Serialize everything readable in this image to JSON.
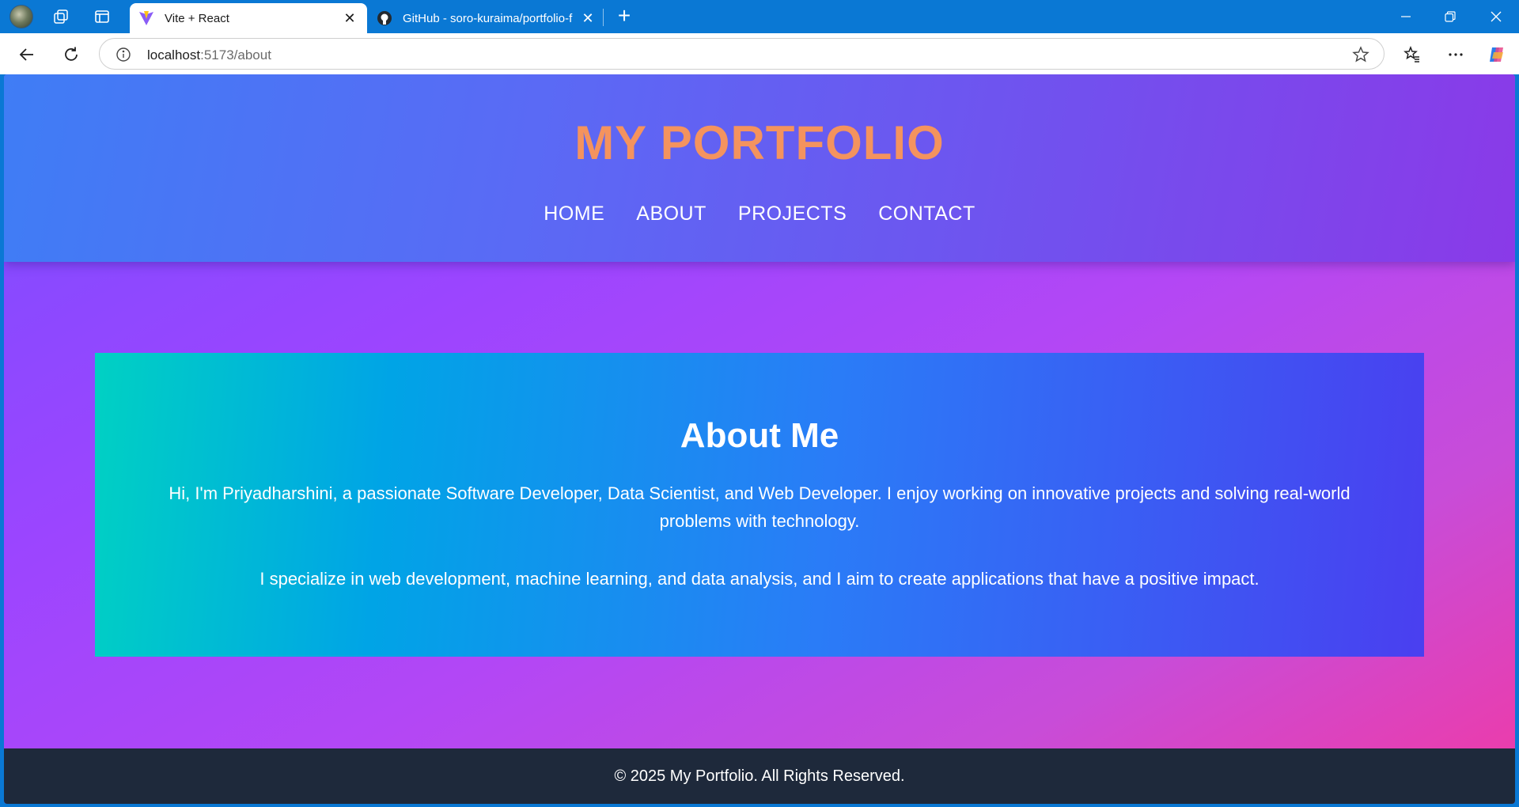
{
  "browser": {
    "tabs": [
      {
        "title": "Vite + React",
        "active": true,
        "favicon": "vite-icon"
      },
      {
        "title": "GitHub - soro-kuraima/portfolio-f",
        "active": false,
        "favicon": "github-icon"
      }
    ],
    "address": {
      "host": "localhost",
      "path": ":5173/about"
    },
    "colors": {
      "chrome": "#0a78d4"
    }
  },
  "site": {
    "title": "MY PORTFOLIO",
    "nav": [
      "HOME",
      "ABOUT",
      "PROJECTS",
      "CONTACT"
    ],
    "about": {
      "heading": "About Me",
      "paragraph1": "Hi, I'm Priyadharshini, a passionate Software Developer, Data Scientist, and Web Developer. I enjoy working on innovative projects and solving real-world problems with technology.",
      "paragraph2": "I specialize in web development, machine learning, and data analysis, and I aim to create applications that have a positive impact."
    },
    "footer": "© 2025 My Portfolio. All Rights Reserved.",
    "colors": {
      "title": "#f4935e",
      "footer_bg": "#1e293b"
    }
  }
}
